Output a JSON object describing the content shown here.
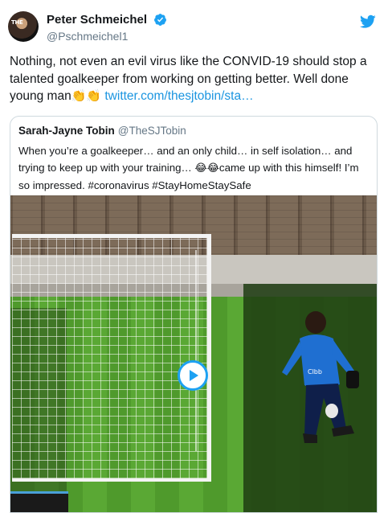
{
  "tweet": {
    "author": {
      "name": "Peter Schmeichel",
      "handle": "@Pschmeichel1",
      "avatar_icon": "profile-photo",
      "verified_icon": "verified-badge-icon"
    },
    "platform_icon": "twitter-bird-icon",
    "text_line": "Nothing, not even an evil virus like the CONVID-19 should stop a talented goalkeeper from working on getting better. Well done young man",
    "emoji_clap": "👏👏",
    "link_text": "twitter.com/thesjtobin/sta…",
    "accent_color": "#1b95e0"
  },
  "quoted": {
    "name": "Sarah-Jayne Tobin",
    "handle": "@TheSJTobin",
    "text_part1": "When you’re a goalkeeper… and an only child… in self isolation… and trying to keep up with your training…",
    "emoji_laugh": "😂😂",
    "text_part2": "came up with this himself! I’m so impressed. #coronavirus #StayHomeStaySafe"
  },
  "video": {
    "play_icon": "play-icon"
  }
}
